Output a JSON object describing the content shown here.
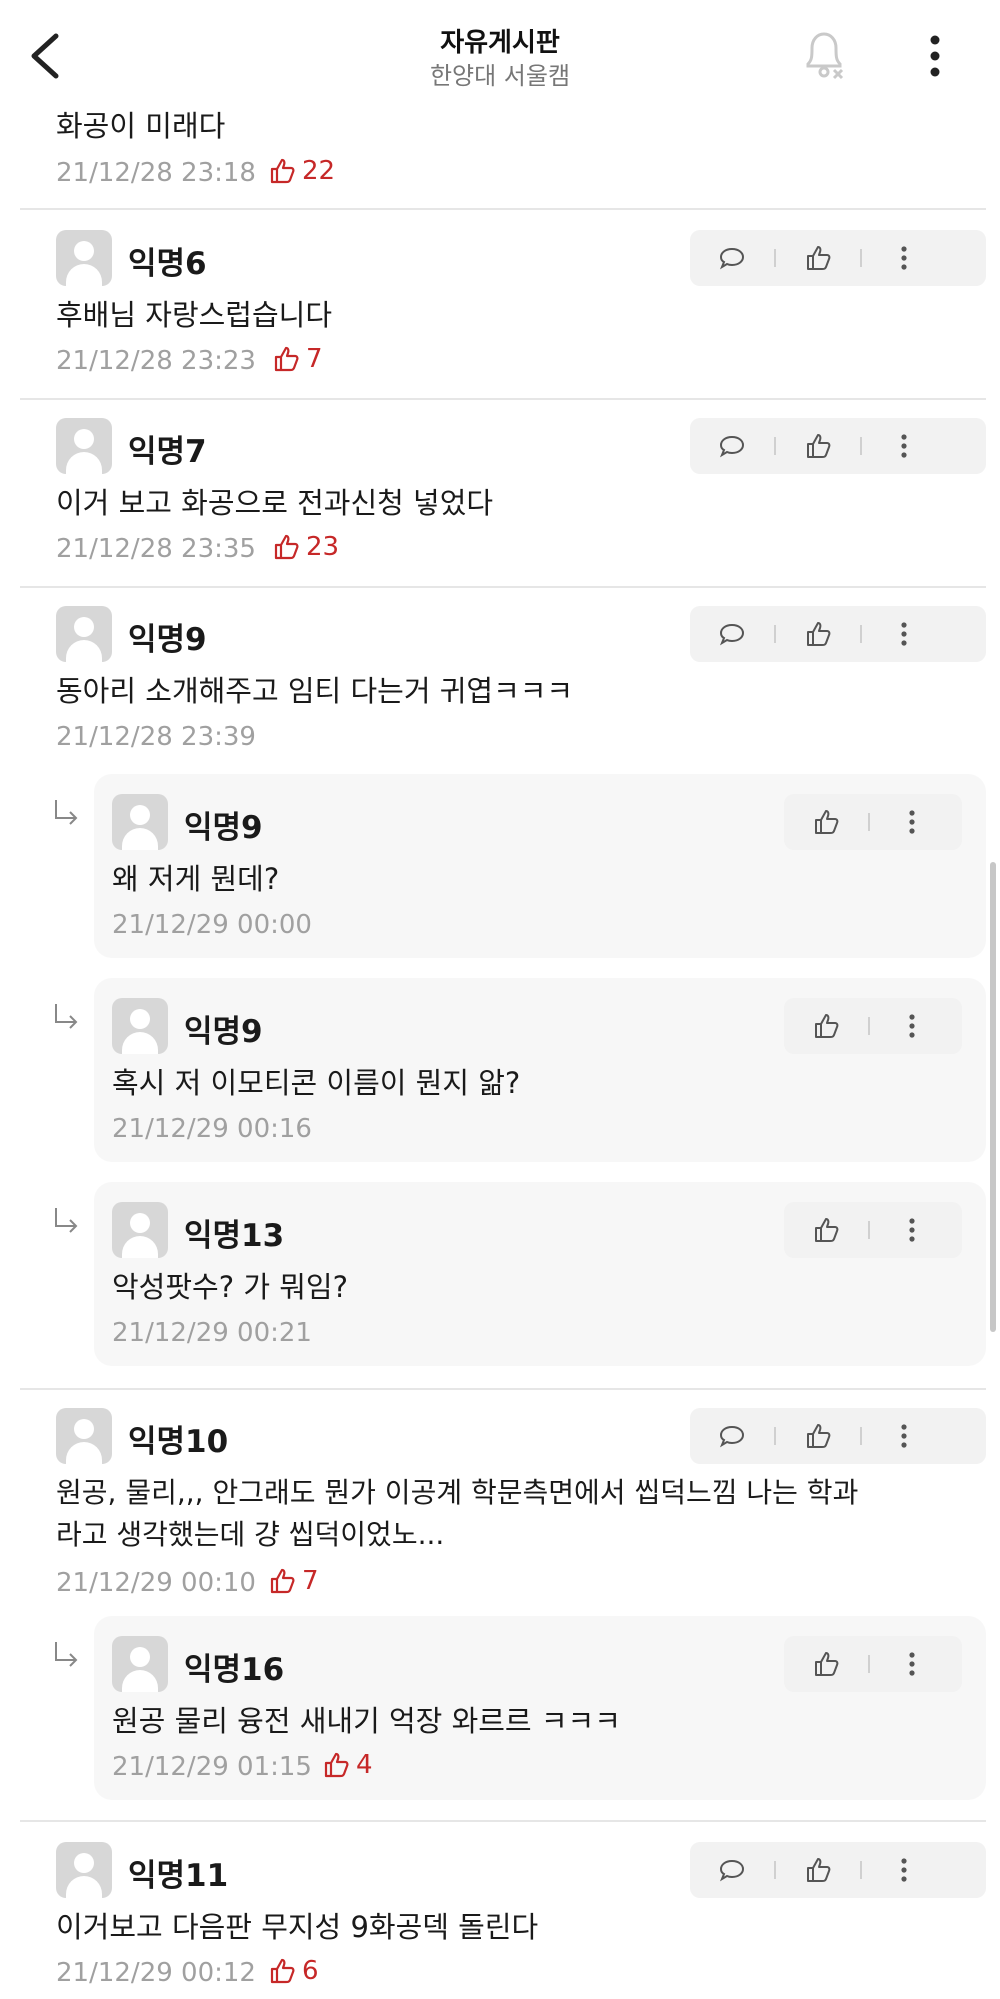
{
  "header": {
    "title": "자유게시판",
    "subtitle": "한양대 서울캠"
  },
  "comments": [
    {
      "name": "",
      "text": "화공이 미래다",
      "time": "21/12/28 23:18",
      "likes": "22"
    },
    {
      "name": "익명6",
      "text": "후배님 자랑스럽습니다",
      "time": "21/12/28 23:23",
      "likes": "7"
    },
    {
      "name": "익명7",
      "text": "이거 보고 화공으로 전과신청 넣었다",
      "time": "21/12/28 23:35",
      "likes": "23"
    },
    {
      "name": "익명9",
      "text": "동아리 소개해주고 임티 다는거 귀엽ㅋㅋㅋ",
      "time": "21/12/28 23:39",
      "likes": ""
    },
    {
      "name": "익명10",
      "text_line1": "원공, 물리,,,  안그래도 뭔가 이공계 학문측면에서 씹덕느낌 나는 학과",
      "text_line2": "라고 생각했는데 걍 씹덕이었노...",
      "time": "21/12/29 00:10",
      "likes": "7"
    },
    {
      "name": "익명11",
      "text": "이거보고 다음판 무지성 9화공덱 돌린다",
      "time": "21/12/29 00:12",
      "likes": "6"
    }
  ],
  "replies": [
    {
      "name": "익명9",
      "text": "왜 저게 뭔데?",
      "time": "21/12/29 00:00",
      "likes": ""
    },
    {
      "name": "익명9",
      "text": "혹시 저 이모티콘 이름이 뭔지 앎?",
      "time": "21/12/29 00:16",
      "likes": ""
    },
    {
      "name": "익명13",
      "text": "악성팟수? 가 뭐임?",
      "time": "21/12/29 00:21",
      "likes": ""
    },
    {
      "name": "익명16",
      "text": "원공 물리 융전 새내기 억장 와르르 ㅋㅋㅋ",
      "time": "21/12/29 01:15",
      "likes": "4"
    }
  ],
  "icons": {
    "back": "chevron-left-icon",
    "bell": "bell-off-icon",
    "more": "more-vertical-icon",
    "reply": "comment-bubble-icon",
    "like": "thumbs-up-icon"
  },
  "colors": {
    "like_red": "#c62828",
    "meta_gray": "#a0a0a0",
    "reply_bg": "#f7f7f7",
    "action_bg": "#f2f2f2"
  }
}
